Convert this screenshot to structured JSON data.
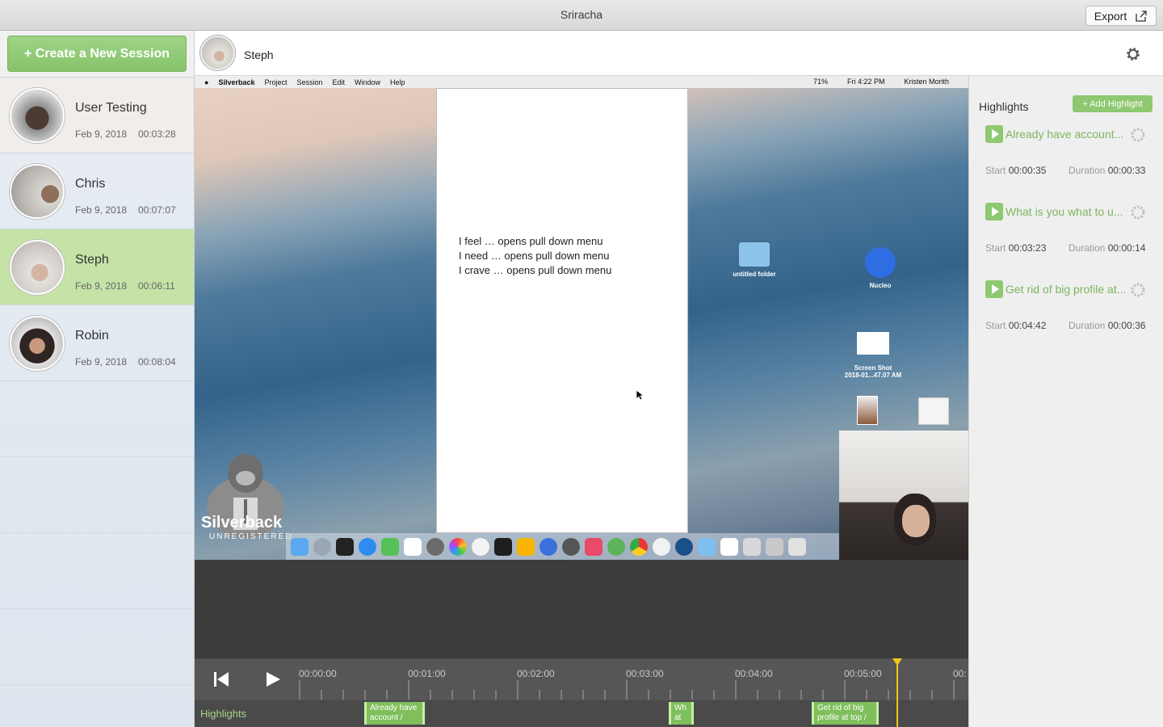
{
  "window": {
    "title": "Sriracha",
    "export_label": "Export"
  },
  "sidebar": {
    "create_label": "+ Create a New Session",
    "sessions": [
      {
        "name": "User Testing",
        "date": "Feb 9, 2018",
        "duration": "00:03:28"
      },
      {
        "name": "Chris",
        "date": "Feb 9, 2018",
        "duration": "00:07:07"
      },
      {
        "name": "Steph",
        "date": "Feb 9, 2018",
        "duration": "00:06:11"
      },
      {
        "name": "Robin",
        "date": "Feb 9, 2018",
        "duration": "00:08:04"
      }
    ]
  },
  "header": {
    "name": "Steph"
  },
  "video": {
    "menubar": [
      "Silverback",
      "Project",
      "Session",
      "Edit",
      "Window",
      "Help"
    ],
    "menubar_right": {
      "battery": "71%",
      "clock": "Fri 4:22 PM",
      "user": "Kristen Morith"
    },
    "doc_lines": [
      "I feel … opens pull down menu",
      "I need … opens pull down menu",
      "I crave … opens pull down menu"
    ],
    "desktop": {
      "folder": "untitled folder",
      "app": "Nucleo",
      "shot1": "Screen Shot",
      "shot2": "2018-01...47.07 AM"
    },
    "watermark": {
      "name": "Silverback",
      "sub": "UNREGISTERED"
    }
  },
  "timeline": {
    "ticks": [
      "00:00:00",
      "00:01:00",
      "00:02:00",
      "00:03:00",
      "00:04:00",
      "00:05:00",
      "00:"
    ],
    "row_label": "Highlights",
    "chips": [
      {
        "line1": "Already have",
        "line2": "account /"
      },
      {
        "line1": "Wh",
        "line2": "at is"
      },
      {
        "line1": "Get rid of big",
        "line2": "profile at top /"
      }
    ]
  },
  "highlights": {
    "title": "Highlights",
    "add_label": "+ Add Highlight",
    "start_label": "Start",
    "duration_label": "Duration",
    "items": [
      {
        "title": "Already have account...",
        "start": "00:00:35",
        "duration": "00:00:33"
      },
      {
        "title": "What is you what to u...",
        "start": "00:03:23",
        "duration": "00:00:14"
      },
      {
        "title": "Get rid of big profile at...",
        "start": "00:04:42",
        "duration": "00:00:36"
      }
    ]
  },
  "colors": {
    "accent_green": "#86c36a",
    "playhead": "#f0c419",
    "selected_row": "#c6e3a7"
  }
}
